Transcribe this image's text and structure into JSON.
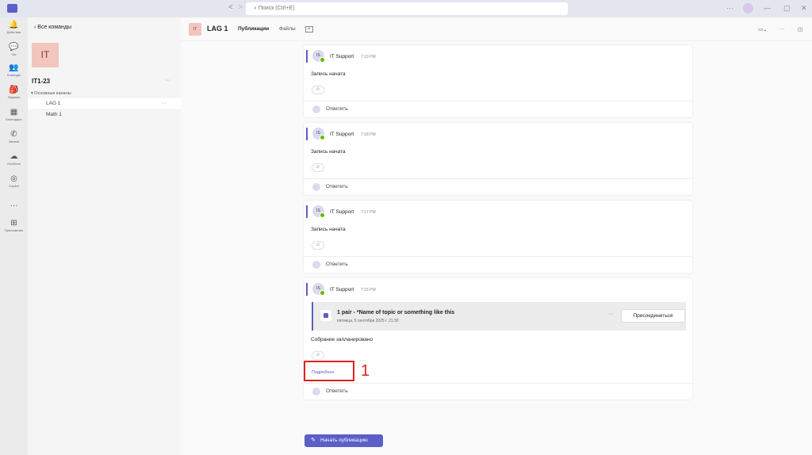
{
  "titlebar": {
    "search_placeholder": "Поиск (Ctrl+E)",
    "back": "<",
    "forward": ">",
    "more": "···",
    "minimize": "—",
    "maximize": "▢",
    "close": "✕"
  },
  "rail": [
    {
      "label": "Действия",
      "icon": "bell-icon",
      "glyph": "🔔"
    },
    {
      "label": "Чат",
      "icon": "chat-icon",
      "glyph": "💬"
    },
    {
      "label": "Команды",
      "icon": "teams-icon",
      "glyph": "👥"
    },
    {
      "label": "Задания",
      "icon": "assignments-icon",
      "glyph": "🎒"
    },
    {
      "label": "Календарь",
      "icon": "calendar-icon",
      "glyph": "▦"
    },
    {
      "label": "Звонки",
      "icon": "phone-icon",
      "glyph": "✆"
    },
    {
      "label": "OneDrive",
      "icon": "cloud-icon",
      "glyph": "☁"
    },
    {
      "label": "Copilot",
      "icon": "copilot-icon",
      "glyph": "◎"
    },
    {
      "label": "",
      "icon": "more-icon",
      "glyph": "···"
    },
    {
      "label": "Приложения",
      "icon": "apps-icon",
      "glyph": "⊞"
    }
  ],
  "panel": {
    "back_label": "Все команды",
    "team_tile": "IT",
    "team_name": "IT1-23",
    "group_label": "▾ Основные каналы",
    "channels": [
      "LAG 1",
      "Math 1"
    ],
    "dots": "···"
  },
  "header": {
    "tile": "IT",
    "title": "LAG 1",
    "tabs": [
      "Публикации",
      "Файлы"
    ],
    "add_tab": "+",
    "video": "▭⌄",
    "more": "···",
    "panel_toggle": "◫"
  },
  "posts": [
    {
      "avatar": "IS",
      "author": "IT Support",
      "time": "7:19 PM",
      "message": "Запись начата",
      "reply": "Ответить"
    },
    {
      "avatar": "IS",
      "author": "IT Support",
      "time": "7:18 PM",
      "message": "Запись начата",
      "reply": "Ответить"
    },
    {
      "avatar": "IS",
      "author": "IT Support",
      "time": "7:17 PM",
      "message": "Запись начата",
      "reply": "Ответить"
    },
    {
      "avatar": "IS",
      "author": "IT Support",
      "time": "7:15 PM",
      "meeting_title": "1 pair - *Name of topic or something like this",
      "meeting_date": "пятница, 5 сентября 2025 г. 21:30",
      "meeting_more": "···",
      "join": "Присоединиться",
      "message": "Собрание запланировано",
      "more_link": "Подробнее",
      "reply": "Ответить"
    }
  ],
  "reaction_icon": "☺",
  "annotation": "1",
  "post_button": "Начать публикацию"
}
